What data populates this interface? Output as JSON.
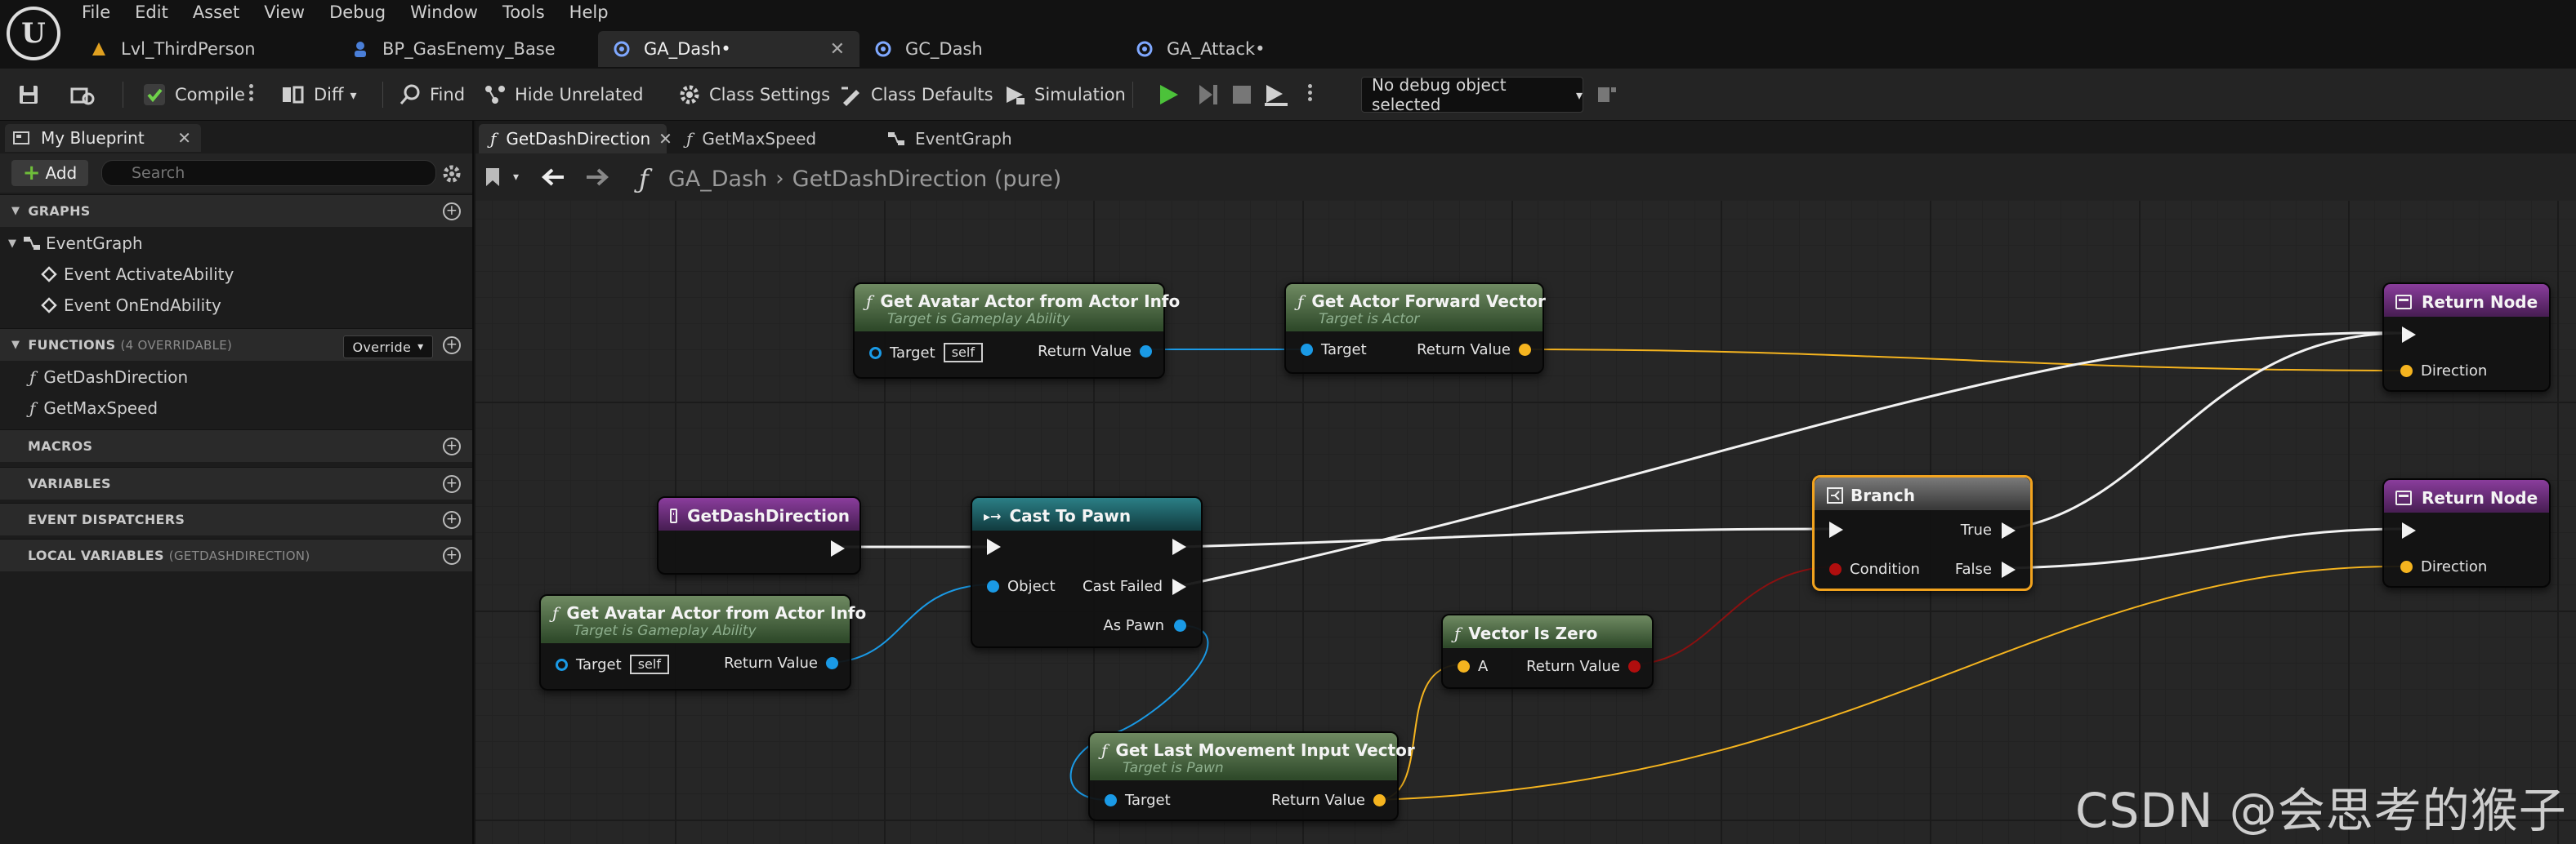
{
  "menu": [
    "File",
    "Edit",
    "Asset",
    "View",
    "Debug",
    "Window",
    "Tools",
    "Help"
  ],
  "doc_tabs": [
    {
      "label": "Lvl_ThirdPerson"
    },
    {
      "label": "BP_GasEnemy_Base"
    },
    {
      "label": "GA_Dash•"
    },
    {
      "label": "GC_Dash"
    },
    {
      "label": "GA_Attack•"
    }
  ],
  "toolbar": {
    "compile": "Compile",
    "diff": "Diff",
    "find": "Find",
    "hide_unrelated": "Hide Unrelated",
    "class_settings": "Class Settings",
    "class_defaults": "Class Defaults",
    "simulation": "Simulation",
    "debug_object": "No debug object selected"
  },
  "my_blueprint": {
    "tab": "My Blueprint",
    "add": "Add",
    "search_placeholder": "Search",
    "graphs_header": "GRAPHS",
    "event_graph": "EventGraph",
    "events": [
      "Event ActivateAbility",
      "Event OnEndAbility"
    ],
    "functions_header": "FUNCTIONS",
    "functions_sub": "(4 OVERRIDABLE)",
    "override": "Override",
    "functions": [
      "GetDashDirection",
      "GetMaxSpeed"
    ],
    "macros_header": "MACROS",
    "variables_header": "VARIABLES",
    "dispatchers_header": "EVENT DISPATCHERS",
    "locals_header": "LOCAL VARIABLES",
    "locals_sub": "(GETDASHDIRECTION)"
  },
  "graph_tabs": [
    "GetDashDirection",
    "GetMaxSpeed",
    "EventGraph"
  ],
  "breadcrumb": {
    "root": "GA_Dash",
    "current": "GetDashDirection (pure)"
  },
  "nodes": {
    "avatar_top": {
      "title": "Get Avatar Actor from Actor Info",
      "subtitle": "Target is Gameplay Ability",
      "target": "Target",
      "self": "self",
      "ret": "Return Value"
    },
    "forward": {
      "title": "Get Actor Forward Vector",
      "subtitle": "Target is Actor",
      "target": "Target",
      "ret": "Return Value"
    },
    "return_top": {
      "title": "Return Node",
      "direction": "Direction"
    },
    "entry": {
      "title": "GetDashDirection"
    },
    "cast": {
      "title": "Cast To Pawn",
      "object": "Object",
      "cast_failed": "Cast Failed",
      "as_pawn": "As Pawn"
    },
    "branch": {
      "title": "Branch",
      "condition": "Condition",
      "true": "True",
      "false": "False"
    },
    "return_bottom": {
      "title": "Return Node",
      "direction": "Direction"
    },
    "avatar_bottom": {
      "title": "Get Avatar Actor from Actor Info",
      "subtitle": "Target is Gameplay Ability",
      "target": "Target",
      "self": "self",
      "ret": "Return Value"
    },
    "is_zero": {
      "title": "Vector Is Zero",
      "a": "A",
      "ret": "Return Value"
    },
    "last_input": {
      "title": "Get Last Movement Input Vector",
      "subtitle": "Target is Pawn",
      "target": "Target",
      "ret": "Return Value"
    }
  },
  "colors": {
    "object_pin": "#1a9ae6",
    "vector_pin": "#f5b41f",
    "bool_pin": "#b00e0e",
    "exec_pin": "#f2f2f2",
    "pure_header": "#2f4a2a",
    "function_header": "#4a1f56",
    "cast_header": "#123e42"
  },
  "watermark": "CSDN @会思考的猴子"
}
